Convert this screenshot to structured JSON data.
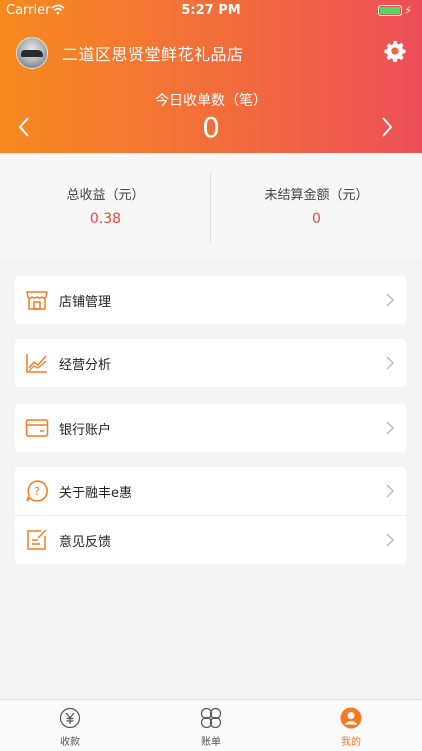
{
  "status": {
    "carrier": "Carrier",
    "time": "5:27 PM"
  },
  "header": {
    "store_name": "二道区思贤堂鲜花礼品店",
    "today_label": "今日收单数（笔）",
    "today_value": "0"
  },
  "summary": {
    "total_label": "总收益（元）",
    "total_value": "0.38",
    "unsettled_label": "未结算金额（元）",
    "unsettled_value": "0"
  },
  "menu": {
    "store_management": "店铺管理",
    "business_analysis": "经营分析",
    "bank_account": "银行账户",
    "about": "关于融丰e惠",
    "feedback": "意见反馈"
  },
  "tabs": {
    "collect": "收款",
    "bills": "账单",
    "mine": "我的"
  },
  "colors": {
    "accent": "#f47b24",
    "header_start": "#f68a1f",
    "header_end": "#ec4f57",
    "value_red": "#e04b3b"
  }
}
